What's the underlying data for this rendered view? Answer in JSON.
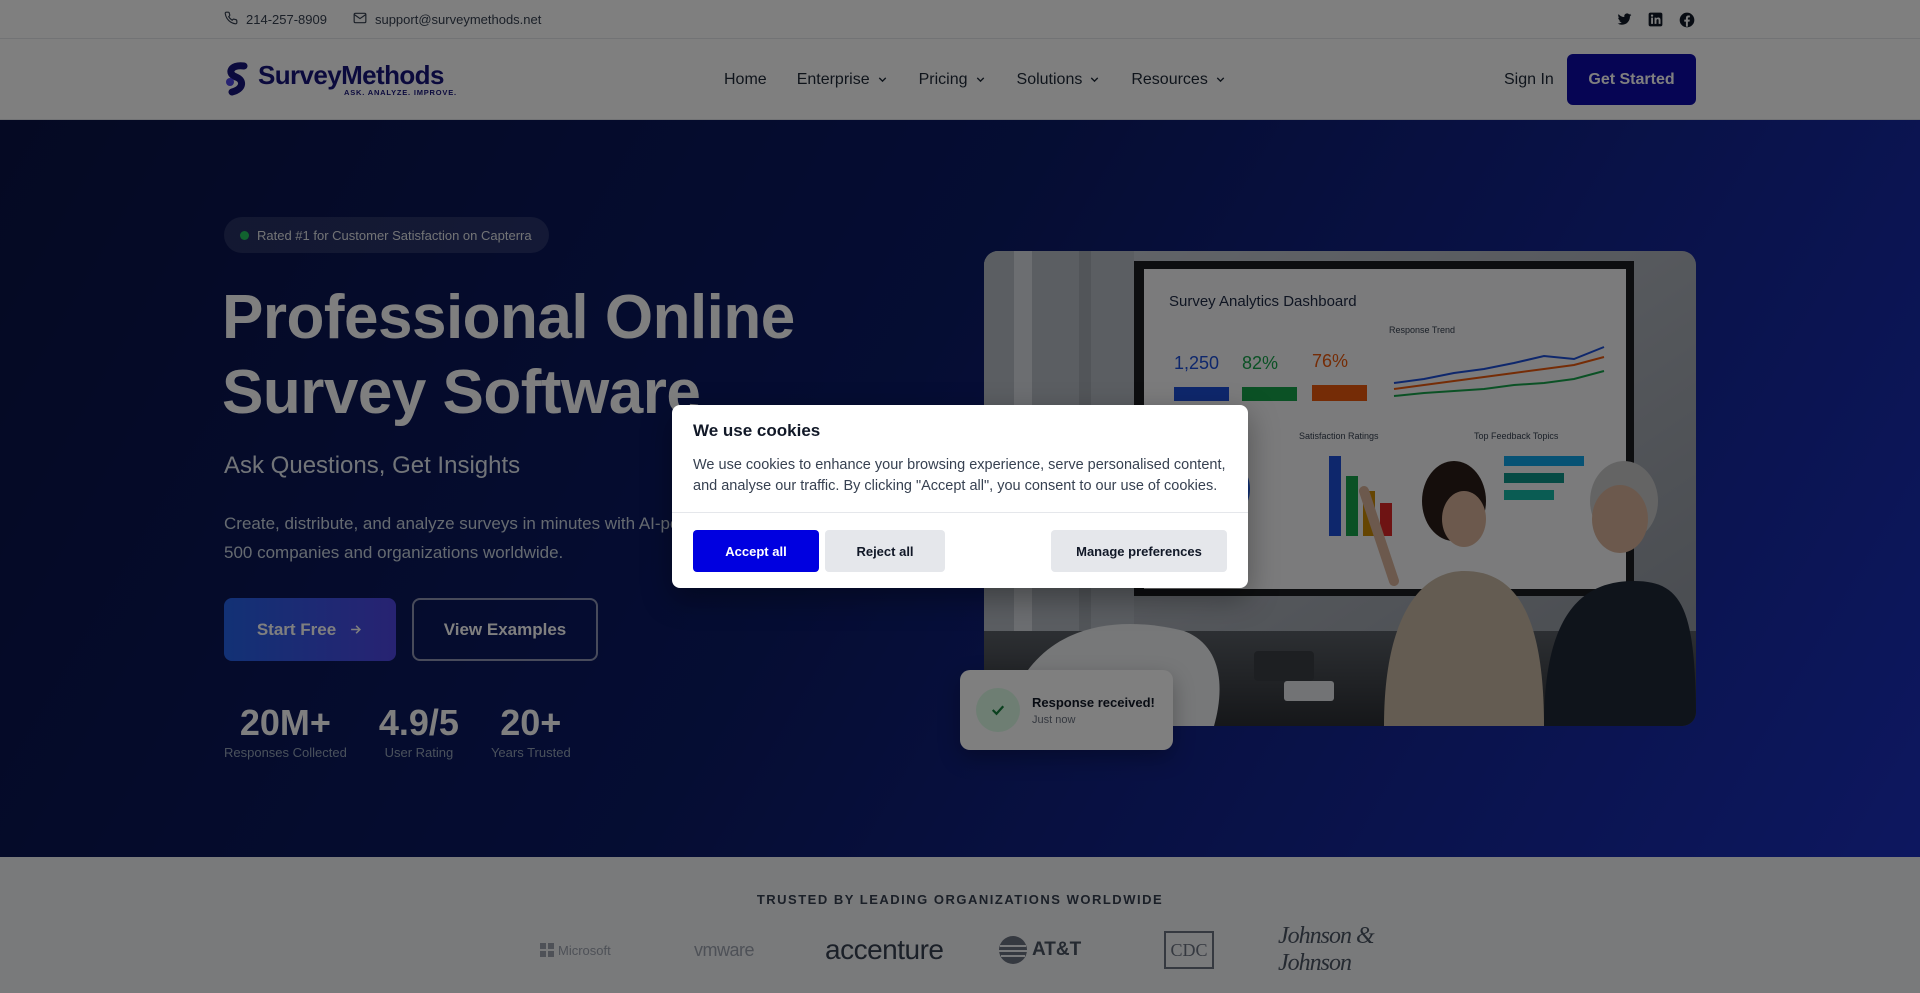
{
  "topbar": {
    "phone": "214-257-8909",
    "email": "support@surveymethods.net",
    "social": [
      "twitter-icon",
      "linkedin-icon",
      "facebook-icon"
    ]
  },
  "nav": {
    "logo_name": "SurveyMethods",
    "logo_tagline": "ASK. ANALYZE. IMPROVE.",
    "items": [
      {
        "label": "Home",
        "dropdown": false
      },
      {
        "label": "Enterprise",
        "dropdown": true
      },
      {
        "label": "Pricing",
        "dropdown": true
      },
      {
        "label": "Solutions",
        "dropdown": true
      },
      {
        "label": "Resources",
        "dropdown": true
      }
    ],
    "sign_in": "Sign In",
    "get_started": "Get Started"
  },
  "hero": {
    "badge": "Rated #1 for Customer Satisfaction on Capterra",
    "title": "Professional Online Survey Software",
    "subtitle": "Ask Questions, Get Insights",
    "lead": "Create, distribute, and analyze surveys in minutes with AI-powered insights. Trusted by Fortune 500 companies and organizations worldwide.",
    "primary_button": "Start Free",
    "secondary_button": "View Examples",
    "stats": [
      {
        "value": "20M+",
        "label": "Responses Collected"
      },
      {
        "value": "4.9/5",
        "label": "User Rating"
      },
      {
        "value": "20+",
        "label": "Years Trusted"
      }
    ],
    "photo": {
      "dashboard_title": "Survey Analytics Dashboard",
      "kpis": [
        "1,250",
        "82%",
        "76%"
      ],
      "chart_titles": [
        "Response Trend",
        "Satisfaction Ratings",
        "Top Feedback Topics"
      ]
    },
    "toast": {
      "title": "Response received!",
      "time": "Just now"
    }
  },
  "trusted": {
    "title": "TRUSTED BY LEADING ORGANIZATIONS WORLDWIDE",
    "logos": [
      "Microsoft",
      "vmware",
      "accenture",
      "AT&T",
      "CDC",
      "Johnson & Johnson"
    ]
  },
  "cookie_modal": {
    "title": "We use cookies",
    "body": "We use cookies to enhance your browsing experience, serve personalised content, and analyse our traffic. By clicking \"Accept all\", you consent to our use of cookies.",
    "accept": "Accept all",
    "reject": "Reject all",
    "manage": "Manage preferences"
  },
  "colors": {
    "brand": "#0c0aa8",
    "accept": "#0000e0",
    "hero_dark": "#0a1346",
    "hero_light": "#1b2fbf"
  }
}
